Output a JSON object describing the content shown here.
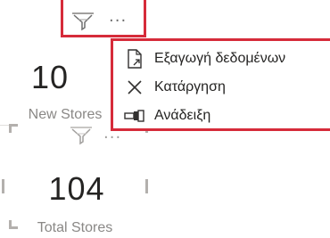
{
  "card1": {
    "value": "10",
    "label": "New Stores"
  },
  "card2": {
    "value": "104",
    "label": "Total Stores"
  },
  "header": {
    "more_label": "···"
  },
  "menu": {
    "items": [
      {
        "label": "Εξαγωγή δεδομένων",
        "icon": "export-data-icon"
      },
      {
        "label": "Κατάργηση",
        "icon": "close-icon"
      },
      {
        "label": "Ανάδειξη",
        "icon": "spotlight-icon"
      }
    ]
  },
  "colors": {
    "highlight_border": "#d62b3a",
    "text": "#252423",
    "muted_text": "#8a8886"
  }
}
